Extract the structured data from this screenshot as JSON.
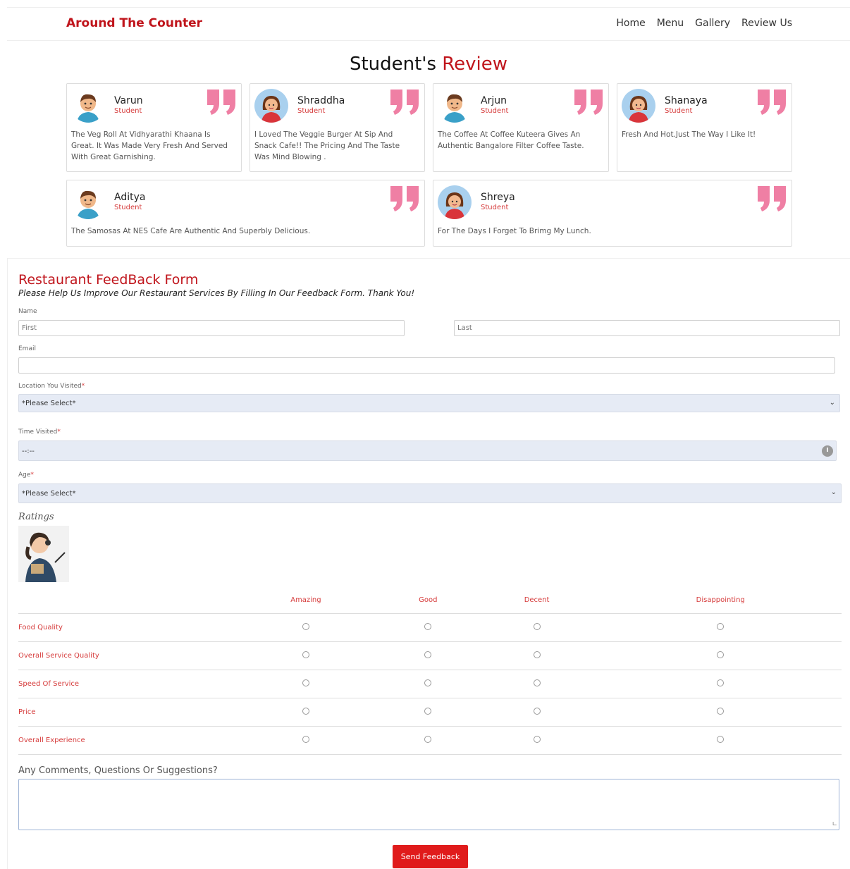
{
  "nav": {
    "brand": "Around The Counter",
    "links": [
      "Home",
      "Menu",
      "Gallery",
      "Review Us"
    ]
  },
  "reviews": {
    "title_prefix": "Student's",
    "title_accent": "Review",
    "cards": [
      {
        "name": "Varun",
        "role": "Student",
        "avatar": "boy-avatar",
        "text": "The Veg Roll At Vidhyarathi Khaana Is Great. It Was Made Very Fresh And Served With Great Garnishing."
      },
      {
        "name": "Shraddha",
        "role": "Student",
        "avatar": "girl-avatar",
        "text": "I Loved The Veggie Burger At Sip And Snack Cafe!! The Pricing And The Taste Was Mind Blowing ."
      },
      {
        "name": "Arjun",
        "role": "Student",
        "avatar": "boy-avatar",
        "text": "The Coffee At Coffee Kuteera Gives An Authentic Bangalore Filter Coffee Taste."
      },
      {
        "name": "Shanaya",
        "role": "Student",
        "avatar": "girl-avatar",
        "text": "Fresh And Hot.Just The Way I Like It!"
      },
      {
        "name": "Aditya",
        "role": "Student",
        "avatar": "boy-avatar",
        "text": "The Samosas At NES Cafe Are Authentic And Superbly Delicious."
      },
      {
        "name": "Shreya",
        "role": "Student",
        "avatar": "girl-avatar",
        "text": "For The Days I Forget To Brimg My Lunch."
      }
    ]
  },
  "form": {
    "title": "Restaurant FeedBack Form",
    "subtitle": "Please Help Us Improve Our Restaurant Services By Filling In Our Feedback Form. Thank You!",
    "name_label": "Name",
    "first_placeholder": "First",
    "last_placeholder": "Last",
    "email_label": "Email",
    "location_label": "Location You Visited",
    "location_value": "*Please Select*",
    "time_label": "Time Visited",
    "time_value": "--:--",
    "age_label": "Age",
    "age_value": "*Please Select*",
    "required_mark": "*",
    "ratings_label": "Ratings",
    "rating_columns": [
      "Amazing",
      "Good",
      "Decent",
      "Disappointing"
    ],
    "rating_rows": [
      "Food Quality",
      "Overall Service Quality",
      "Speed Of Service",
      "Price",
      "Overall Experience"
    ],
    "comments_label": "Any Comments, Questions Or Suggestions?",
    "submit_label": "Send Feedback"
  },
  "colors": {
    "accent": "#c0151c",
    "button": "#e01b1b",
    "quote_mark": "#ef7fa4",
    "select_bg": "#e6ebf5"
  }
}
